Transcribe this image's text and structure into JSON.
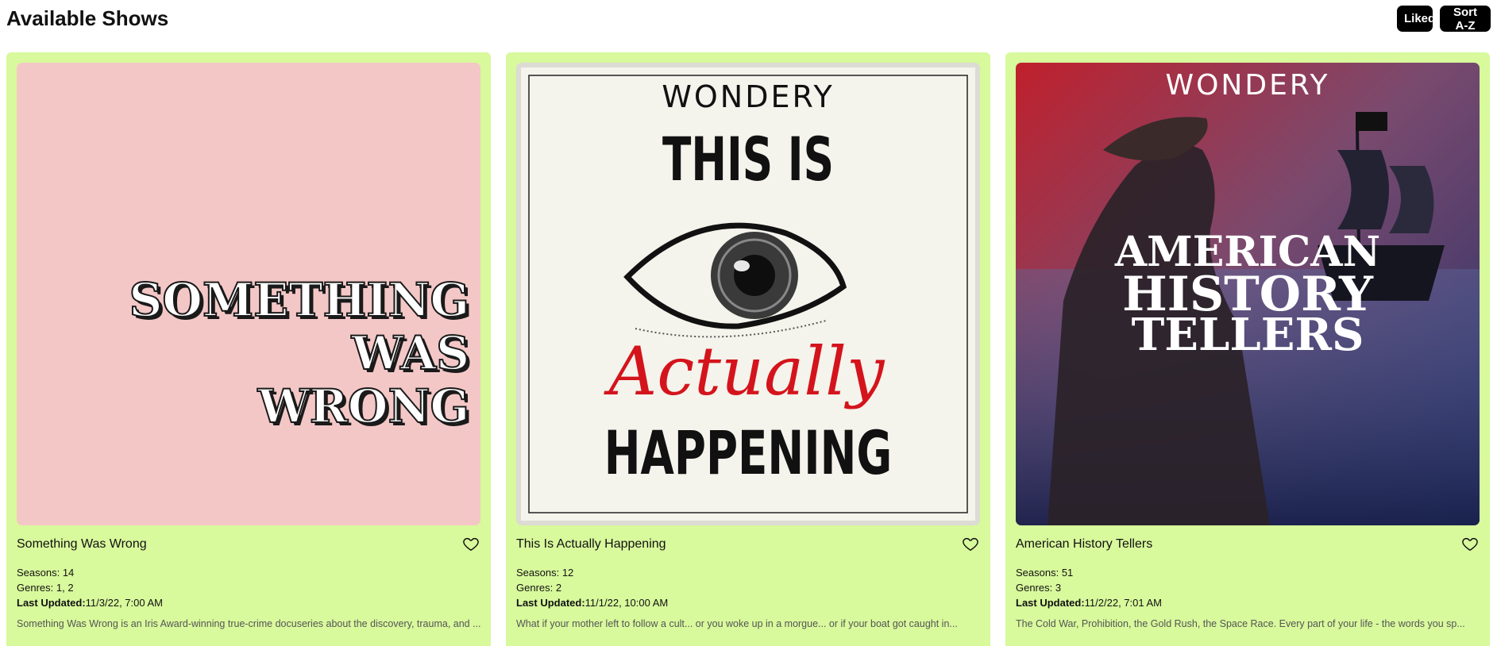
{
  "header": {
    "title": "Available Shows",
    "liked_label": "Liked",
    "sort_label": "Sort A-Z"
  },
  "labels": {
    "seasons": "Seasons: ",
    "genres": "Genres: ",
    "updated": "Last Updated:"
  },
  "shows": [
    {
      "title": "Something Was Wrong",
      "seasons": "14",
      "genres": "1, 2",
      "updated": "11/3/22, 7:00 AM",
      "description": "Something Was Wrong is an Iris Award-winning true-crime docuseries about the discovery, trauma, and ...",
      "art_text": [
        "SOMETHING",
        "WAS",
        "WRONG"
      ],
      "art_bg": "#f4c7c7"
    },
    {
      "title": "This Is Actually Happening",
      "seasons": "12",
      "genres": "2",
      "updated": "11/1/22, 10:00 AM",
      "description": "What if your mother left to follow a cult... or you woke up in a morgue... or if your boat got caught in...",
      "art_text": [
        "WONDERY",
        "THIS IS",
        "Actually",
        "HAPPENING"
      ],
      "art_bg": "#f4f3ec"
    },
    {
      "title": "American History Tellers",
      "seasons": "51",
      "genres": "3",
      "updated": "11/2/22, 7:01 AM",
      "description": "The Cold War, Prohibition, the Gold Rush, the Space Race. Every part of your life - the words you sp...",
      "art_text": [
        "WONDERY",
        "AMERICAN",
        "HISTORY",
        "TELLERS"
      ],
      "art_bg": "#3a2f4a"
    }
  ],
  "colors": {
    "card_bg": "#d8f99c",
    "button_bg": "#000000",
    "accent_red": "#d4141c"
  },
  "icons": {
    "favorite": "heart-outline-icon"
  }
}
